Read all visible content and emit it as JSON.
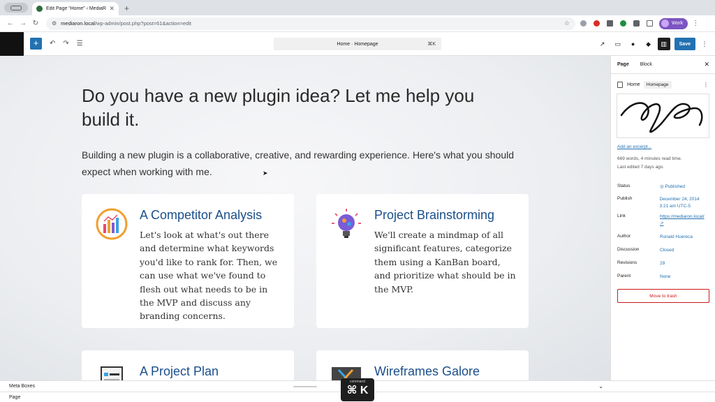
{
  "browser": {
    "tab_title": "Edit Page “Home” ‹ MediaRo...",
    "url_host": "mediaron.local",
    "url_path": "/wp-admin/post.php?post=61&action=edit",
    "profile_label": "Work"
  },
  "editor": {
    "document_title": "Home · Homepage",
    "document_shortcut": "⌘K",
    "save_label": "Save"
  },
  "content": {
    "heading": "Do you have a new plugin idea? Let me help you build it.",
    "intro": "Building a new plugin is a collaborative, creative, and rewarding experience. Here's what you should expect when working with me.",
    "cards": [
      {
        "title": "A Competitor Analysis",
        "body": "Let's look at what's out there and determine what keywords you'd like to rank for. Then, we can use what we've found to flesh out what needs to be in the MVP and discuss any branding concerns."
      },
      {
        "title": "Project Brainstorming",
        "body": "We'll create a mindmap of all significant features, categorize them using a KanBan board, and prioritize what should be in the MVP."
      },
      {
        "title": "A Project Plan",
        "body": ""
      },
      {
        "title": "Wireframes Galore",
        "body": ""
      }
    ]
  },
  "sidebar": {
    "tab_page": "Page",
    "tab_block": "Block",
    "page_title": "Home",
    "page_badge": "Homepage",
    "excerpt_link": "Add an excerpt...",
    "word_count": "669 words, 4 minutes read time.",
    "last_edited": "Last edited 7 days ago.",
    "rows": [
      {
        "key": "Status",
        "value": "Published"
      },
      {
        "key": "Publish",
        "value": "December 24, 2014 3:21 am UTC-5"
      },
      {
        "key": "Link",
        "value": "https://mediaron.local/ ↗"
      },
      {
        "key": "Author",
        "value": "Ronald Huereca"
      },
      {
        "key": "Discussion",
        "value": "Closed"
      },
      {
        "key": "Revisions",
        "value": "29"
      },
      {
        "key": "Parent",
        "value": "None"
      }
    ],
    "trash_label": "Move to trash"
  },
  "footer": {
    "meta_boxes": "Meta Boxes",
    "breadcrumb": "Page"
  },
  "overlay": {
    "caption": "command",
    "keys": "⌘ K"
  },
  "colors": {
    "accent": "#2271b1",
    "danger": "#cc1818",
    "card_title": "#1a4f8b"
  }
}
